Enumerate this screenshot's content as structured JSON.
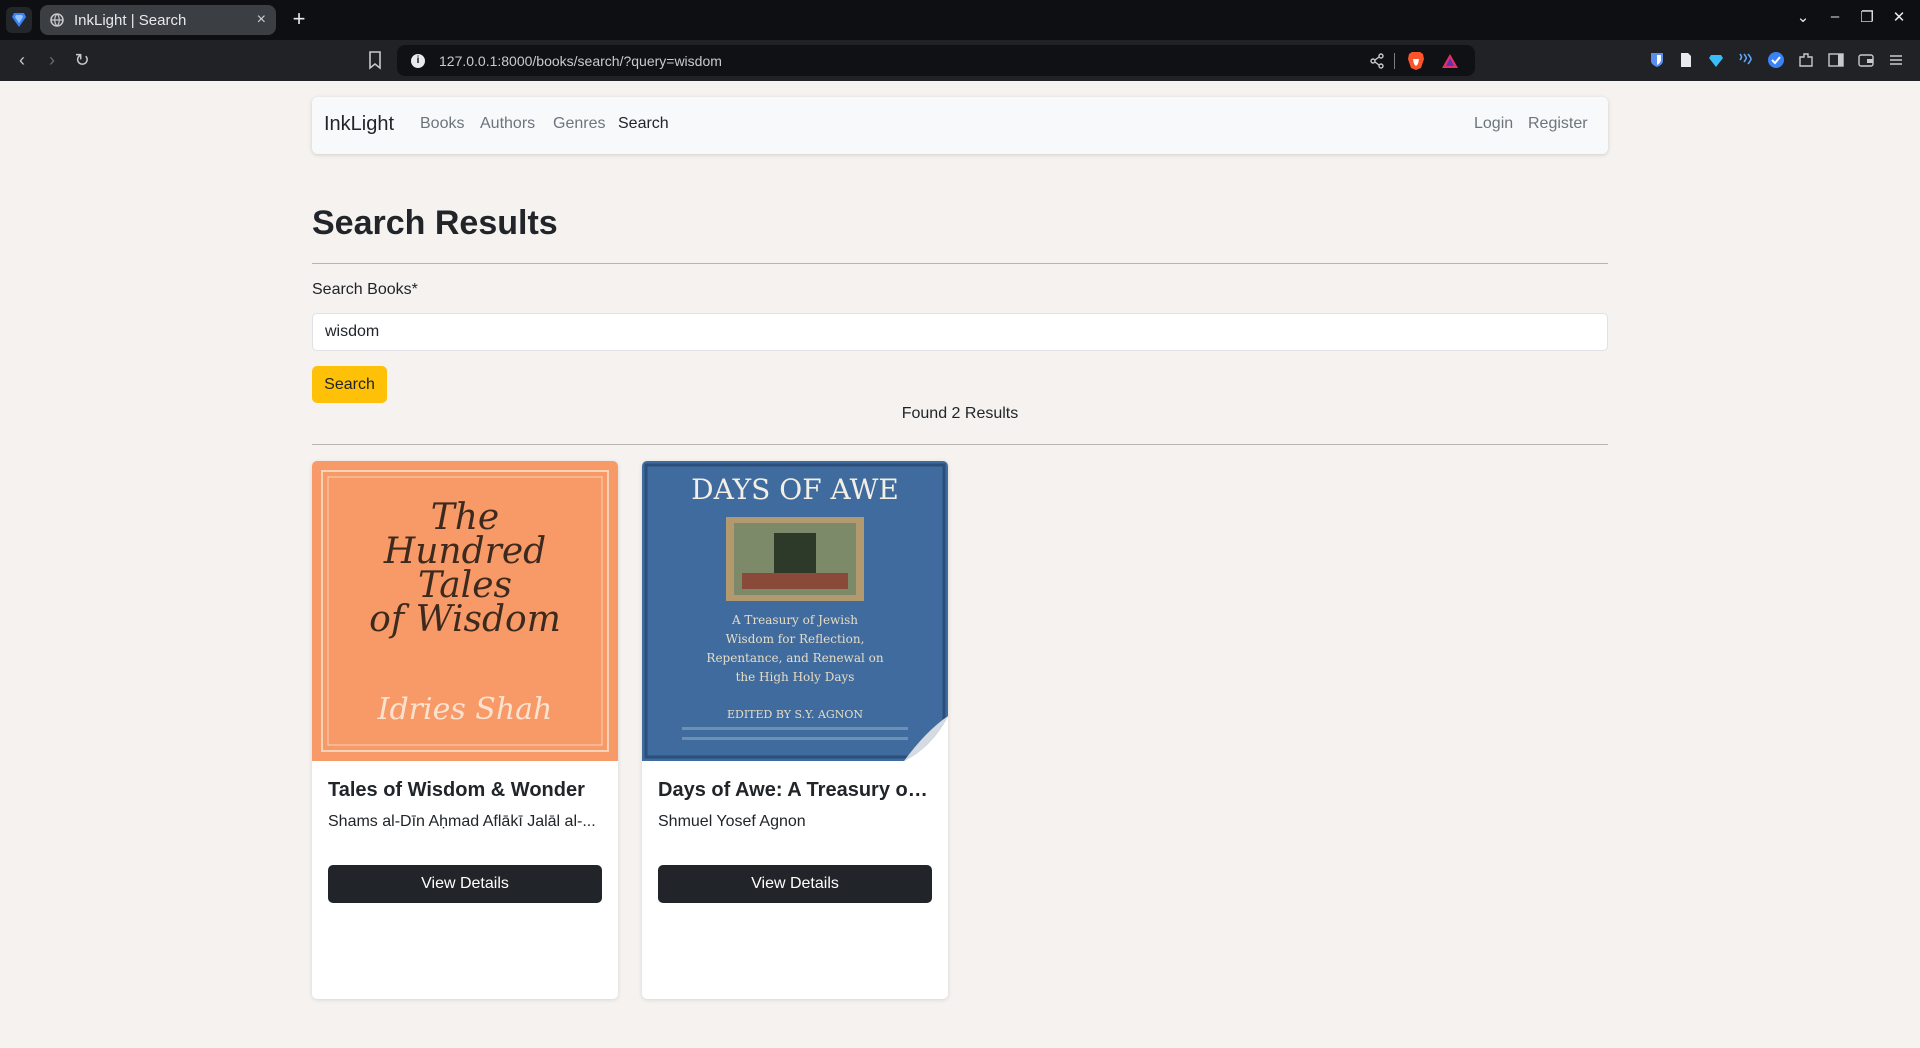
{
  "browser": {
    "tab_title": "InkLight | Search",
    "tab_close": "×",
    "new_tab": "+",
    "url": "127.0.0.1:8000/books/search/?query=wisdom"
  },
  "navbar": {
    "brand": "InkLight",
    "links": [
      "Books",
      "Authors",
      "Genres",
      "Search"
    ],
    "active": "Search",
    "login": "Login",
    "register": "Register"
  },
  "main": {
    "title": "Search Results",
    "search_label": "Search Books*",
    "search_value": "wisdom",
    "search_button": "Search",
    "found_text": "Found 2 Results"
  },
  "results": [
    {
      "title": "Tales of Wisdom & Wonder",
      "author": "Shams al-Dīn Aḥmad Aflākī Jalāl al-...",
      "button": "View Details",
      "cover": {
        "lines": [
          "The",
          "Hundred",
          "Tales",
          "of Wisdom"
        ],
        "author_line": "Idries Shah",
        "bg": "#f79a67"
      }
    },
    {
      "title": "Days of Awe: A Treasury of Je...",
      "author": "Shmuel Yosef Agnon",
      "button": "View Details",
      "cover": {
        "heading": "DAYS OF AWE",
        "subtitle": [
          "A Treasury of Jewish",
          "Wisdom for Reflection,",
          "Repentance, and Renewal on",
          "the High Holy Days"
        ],
        "editor": "EDITED BY S.Y. AGNON",
        "bg": "#3f6b9e"
      }
    }
  ],
  "colors": {
    "accent": "#ffc107",
    "dark_button": "#212529",
    "page_bg": "#f5f2ef"
  }
}
